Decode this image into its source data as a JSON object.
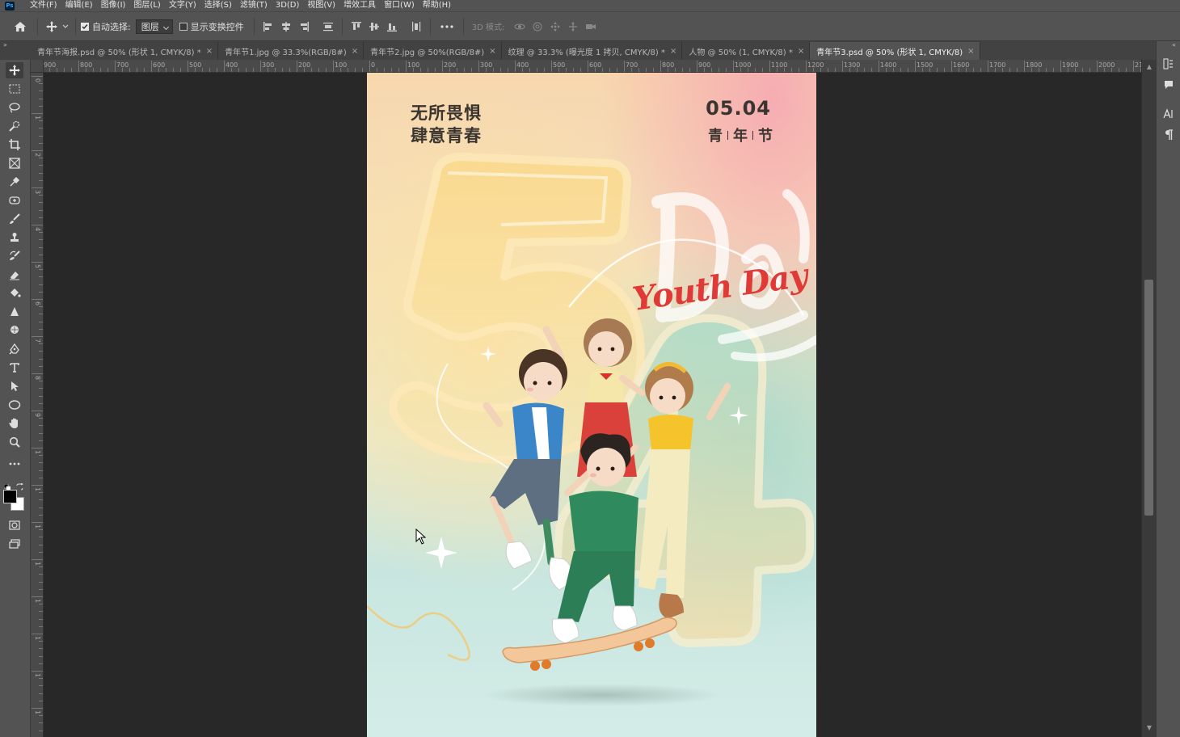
{
  "app": {
    "logo_text": "Ps"
  },
  "menu": [
    {
      "label": "文件(F)"
    },
    {
      "label": "编辑(E)"
    },
    {
      "label": "图像(I)"
    },
    {
      "label": "图层(L)"
    },
    {
      "label": "文字(Y)"
    },
    {
      "label": "选择(S)"
    },
    {
      "label": "滤镜(T)"
    },
    {
      "label": "3D(D)"
    },
    {
      "label": "视图(V)"
    },
    {
      "label": "增效工具"
    },
    {
      "label": "窗口(W)"
    },
    {
      "label": "帮助(H)"
    }
  ],
  "options": {
    "auto_select_label": "自动选择:",
    "auto_select_checked": true,
    "auto_select_target": "图层",
    "show_transform_label": "显示变换控件",
    "show_transform_checked": false,
    "mode_3d_label": "3D 模式:"
  },
  "tabs": [
    {
      "label": "青年节海报.psd @ 50% (形状 1, CMYK/8) *",
      "active": false
    },
    {
      "label": "青年节1.jpg @ 33.3%(RGB/8#)",
      "active": false
    },
    {
      "label": "青年节2.jpg @ 50%(RGB/8#)",
      "active": false
    },
    {
      "label": "纹理 @ 33.3% (曝光度 1 拷贝, CMYK/8) *",
      "active": false
    },
    {
      "label": "人物 @ 50% (1, CMYK/8) *",
      "active": false
    },
    {
      "label": "青年节3.psd @ 50% (形状 1, CMYK/8)",
      "active": true
    }
  ],
  "tab_close_glyph": "×",
  "ruler_top_labels": [
    "900",
    "800",
    "700",
    "600",
    "500",
    "400",
    "300",
    "200",
    "100",
    "0",
    "100",
    "200",
    "300",
    "400",
    "500",
    "600",
    "700",
    "800",
    "900",
    "1000",
    "1100",
    "1200",
    "1300",
    "1400",
    "1500",
    "1600",
    "1700",
    "1800",
    "1900",
    "2000",
    "2100"
  ],
  "ruler_left_labels": [
    "0",
    "1",
    "2",
    "3",
    "4",
    "5",
    "6",
    "7",
    "8",
    "9",
    "1",
    "1",
    "1",
    "1",
    "1",
    "1",
    "1",
    "1"
  ],
  "poster": {
    "slogan_line1": "无所畏惧",
    "slogan_line2": "肆意青春",
    "date": "05.04",
    "festival_chars": [
      "青",
      "年",
      "节"
    ],
    "youth_day": "Youth Day",
    "colors": {
      "accent_red": "#e03a36",
      "text_dark": "#3a3530"
    }
  },
  "toolbar_tools": [
    {
      "name": "move-tool-icon",
      "active": true
    },
    {
      "name": "marquee-tool-icon"
    },
    {
      "name": "lasso-tool-icon"
    },
    {
      "name": "quick-select-tool-icon"
    },
    {
      "name": "crop-tool-icon"
    },
    {
      "name": "frame-tool-icon"
    },
    {
      "name": "eyedropper-tool-icon"
    },
    {
      "name": "healing-brush-tool-icon"
    },
    {
      "name": "brush-tool-icon"
    },
    {
      "name": "clone-stamp-tool-icon"
    },
    {
      "name": "history-brush-tool-icon"
    },
    {
      "name": "eraser-tool-icon"
    },
    {
      "name": "paint-bucket-tool-icon"
    },
    {
      "name": "blur-tool-icon"
    },
    {
      "name": "dodge-tool-icon"
    },
    {
      "name": "pen-tool-icon"
    },
    {
      "name": "type-tool-icon"
    },
    {
      "name": "path-select-tool-icon"
    },
    {
      "name": "ellipse-tool-icon"
    },
    {
      "name": "hand-tool-icon"
    },
    {
      "name": "zoom-tool-icon"
    },
    {
      "name": "more-tools-icon"
    }
  ],
  "right_panel_icons": [
    "history-panel-icon",
    "comment-panel-icon",
    "character-panel-icon",
    "paragraph-panel-icon"
  ],
  "colors": {
    "chrome": "#535353",
    "canvas_bg": "#282828",
    "foreground": "#000000",
    "background": "#ffffff"
  }
}
